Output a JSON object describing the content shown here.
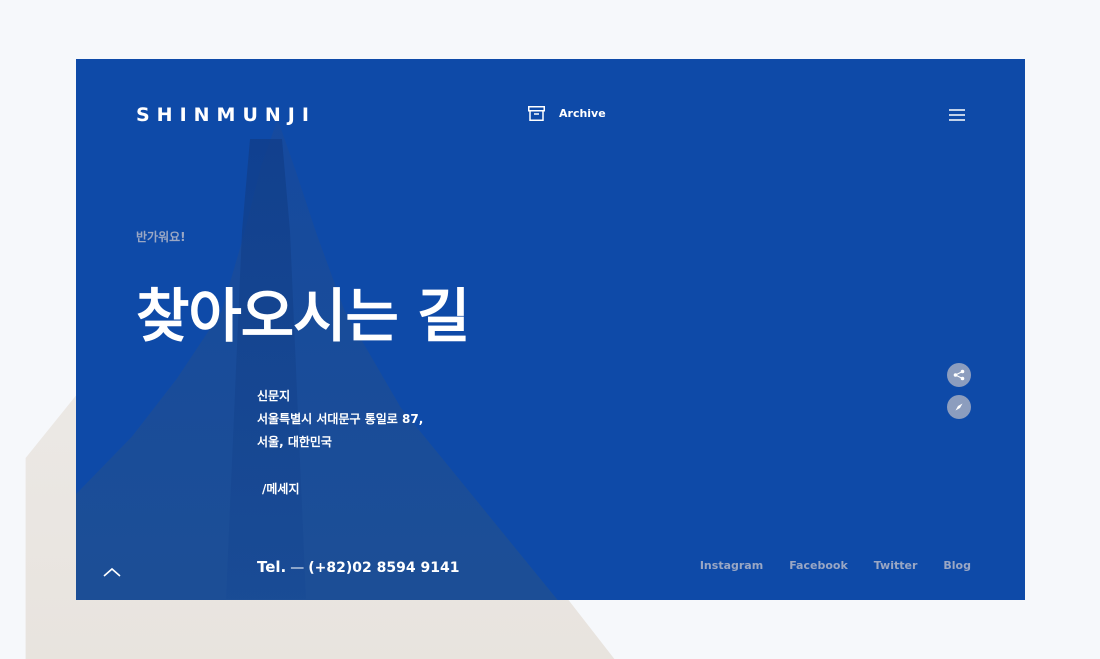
{
  "brand": {
    "logo_text": "SHINMUNJI"
  },
  "header": {
    "archive_label": "Archive",
    "archive_icon": "archive-box-icon",
    "menu_icon": "hamburger-menu-icon"
  },
  "hero": {
    "greeting": "반가워요!",
    "title": "찾아오시는 길"
  },
  "address": {
    "name": "신문지",
    "line1": "서울특별시 서대문구 통일로 87,",
    "line2": "서울, 대한민국"
  },
  "message_link": "/메세지",
  "contact": {
    "tel_label": "Tel.",
    "dash": "—",
    "tel_number": "(+82)02 8594 9141"
  },
  "social": [
    "Instagram",
    "Facebook",
    "Twitter",
    "Blog"
  ],
  "side_actions": {
    "share_icon": "share-icon",
    "compass_icon": "compass-icon"
  },
  "colors": {
    "panel_bg": "#0e4aa8",
    "page_bg": "#f6f8fb",
    "muted_text": "#9aa7c4",
    "text": "#ffffff"
  }
}
